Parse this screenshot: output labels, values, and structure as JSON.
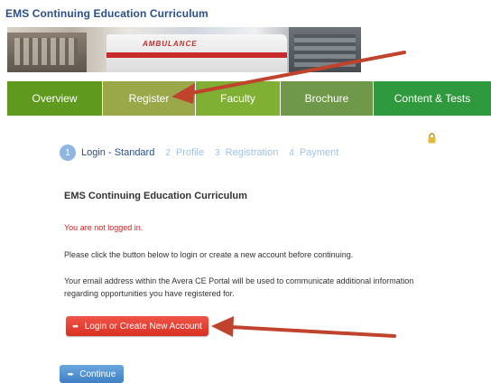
{
  "header": {
    "title": "EMS Continuing Education Curriculum"
  },
  "banner": {
    "ambulance_text": "AMBULANCE"
  },
  "nav": {
    "items": [
      {
        "label": "Overview",
        "color": "#5f9a1f"
      },
      {
        "label": "Register",
        "color": "#9aa84a"
      },
      {
        "label": "Faculty",
        "color": "#7fb034"
      },
      {
        "label": "Brochure",
        "color": "#6f9848"
      },
      {
        "label": "Content & Tests",
        "color": "#2f9a3d"
      }
    ]
  },
  "steps": [
    {
      "num": "1",
      "label": "Login - Standard"
    },
    {
      "num": "2",
      "label": "Profile"
    },
    {
      "num": "3",
      "label": "Registration"
    },
    {
      "num": "4",
      "label": "Payment"
    }
  ],
  "content": {
    "section_title": "EMS Continuing Education Curriculum",
    "alert": "You are not logged in.",
    "paragraph1": "Please click the button below to login or create a new account before continuing.",
    "paragraph2": "Your email address within the Avera CE Portal will be used to communicate additional information regarding opportunities you have registered for."
  },
  "buttons": {
    "login": "Login or Create New Account",
    "continue": "Continue"
  },
  "icons": {
    "lock": "lock-icon",
    "login": "sign-in-icon",
    "continue": "sign-in-icon"
  },
  "colors": {
    "title": "#2a4f8a",
    "alert": "#d02020",
    "login_button": "#e2392d",
    "continue_button": "#4a8bd0",
    "annotation_arrow": "#c0432e"
  }
}
